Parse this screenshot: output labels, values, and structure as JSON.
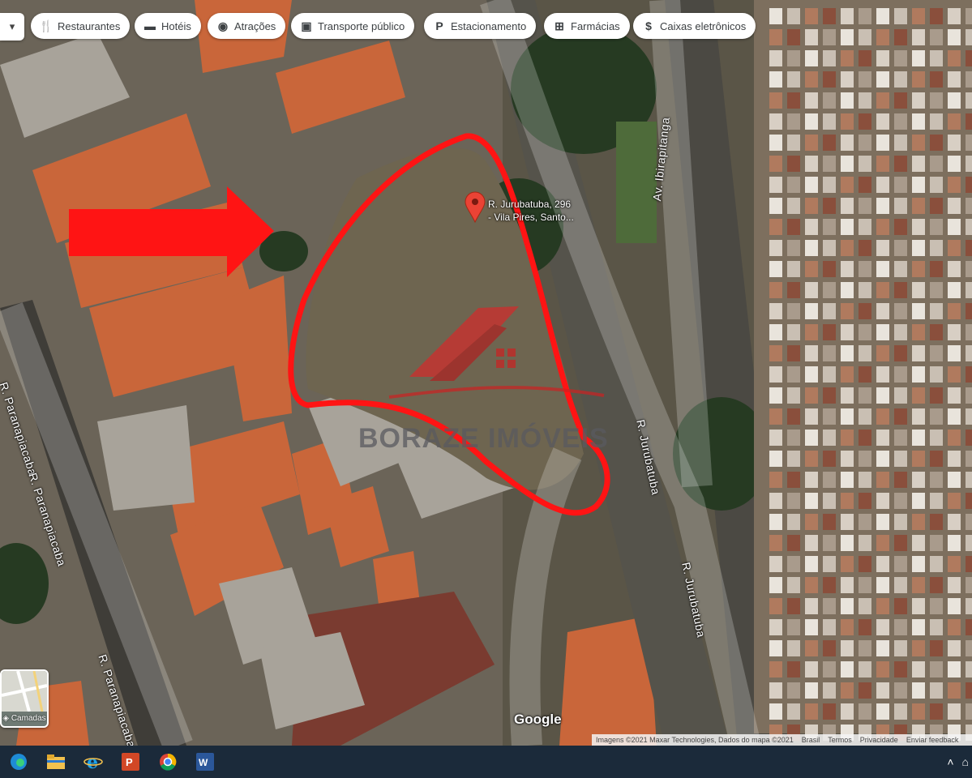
{
  "filter_chips": [
    {
      "label": "Restaurantes",
      "icon": "fork-knife-icon"
    },
    {
      "label": "Hotéis",
      "icon": "bed-icon"
    },
    {
      "label": "Atrações",
      "icon": "camera-icon"
    },
    {
      "label": "Transporte público",
      "icon": "bus-icon"
    },
    {
      "label": "Estacionamento",
      "icon": "parking-icon"
    },
    {
      "label": "Farmácias",
      "icon": "pharmacy-icon"
    },
    {
      "label": "Caixas eletrônicos",
      "icon": "atm-icon"
    }
  ],
  "streets": {
    "ibirapitanga": "Av. Ibirapitanga",
    "jurubatuba_upper": "R. Jurubatuba",
    "jurubatuba_lower": "R. Jurubatuba",
    "paranapiacaba_upper": "R. Paranapiacaba",
    "paranapiacaba_lower": "R. Paranapiacaba"
  },
  "place_pin": {
    "line1": "R. Jurubatuba, 296",
    "line2": "- Vila Pires, Santo..."
  },
  "watermark": "BORAZE IMÓVEIS",
  "google_logo": "Google",
  "layers_button": {
    "label": "Camadas",
    "icon": "layers-icon"
  },
  "attribution": {
    "imagery": "Imagens ©2021 Maxar Technologies, Dados do mapa ©2021",
    "country": "Brasil",
    "terms": "Termos",
    "privacy": "Privacidade",
    "feedback": "Enviar feedback"
  },
  "taskbar": {
    "apps": [
      "edge-icon",
      "file-explorer-icon",
      "internet-explorer-icon",
      "powerpoint-icon",
      "chrome-icon",
      "word-icon"
    ]
  },
  "colors": {
    "highlight_red": "#ff1414",
    "watermark_gray": "#5a5a5f",
    "taskbar": "#1b2a3a"
  }
}
